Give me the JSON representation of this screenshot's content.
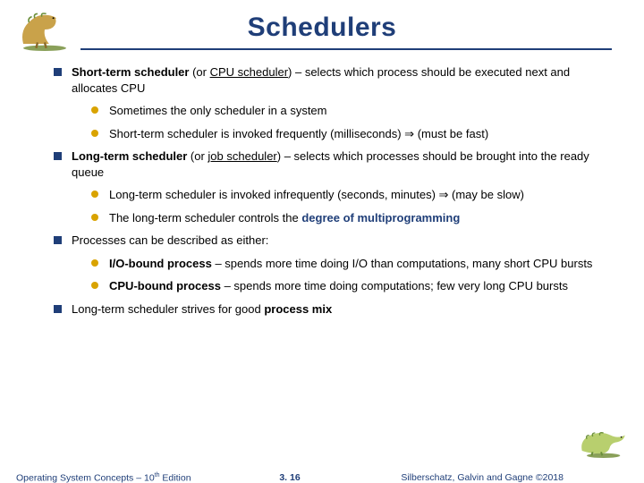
{
  "title": "Schedulers",
  "b1": {
    "lead": "Short-term scheduler",
    "mid1": "  (or ",
    "u1": "CPU scheduler",
    "tail": ") – selects which process should be executed next and allocates CPU",
    "s1": "Sometimes the only scheduler in a system",
    "s2": "Short-term scheduler is invoked frequently (milliseconds) ⇒ (must be fast)"
  },
  "b2": {
    "lead": "Long-term scheduler",
    "mid1": "  (or ",
    "u1": "job scheduler",
    "tail": ") – selects which processes should be brought into the ready queue",
    "s1": "Long-term scheduler is invoked  infrequently (seconds, minutes) ⇒ (may be slow)",
    "s2a": "The long-term scheduler controls the ",
    "s2b": "degree of multiprogramming"
  },
  "b3": {
    "text": "Processes can be described as either:",
    "s1a": "I/O-bound process",
    "s1b": " – spends more time doing I/O than computations, many short CPU bursts",
    "s2a": "CPU-bound process",
    "s2b": " – spends more time doing computations; few very long CPU bursts"
  },
  "b4": {
    "a": "Long-term scheduler strives for good ",
    "b": "process mix"
  },
  "footer": {
    "left_a": "Operating System Concepts – 10",
    "left_b": "th",
    "left_c": " Edition",
    "center": "3. 16",
    "right": "Silberschatz, Galvin and Gagne ©2018"
  }
}
